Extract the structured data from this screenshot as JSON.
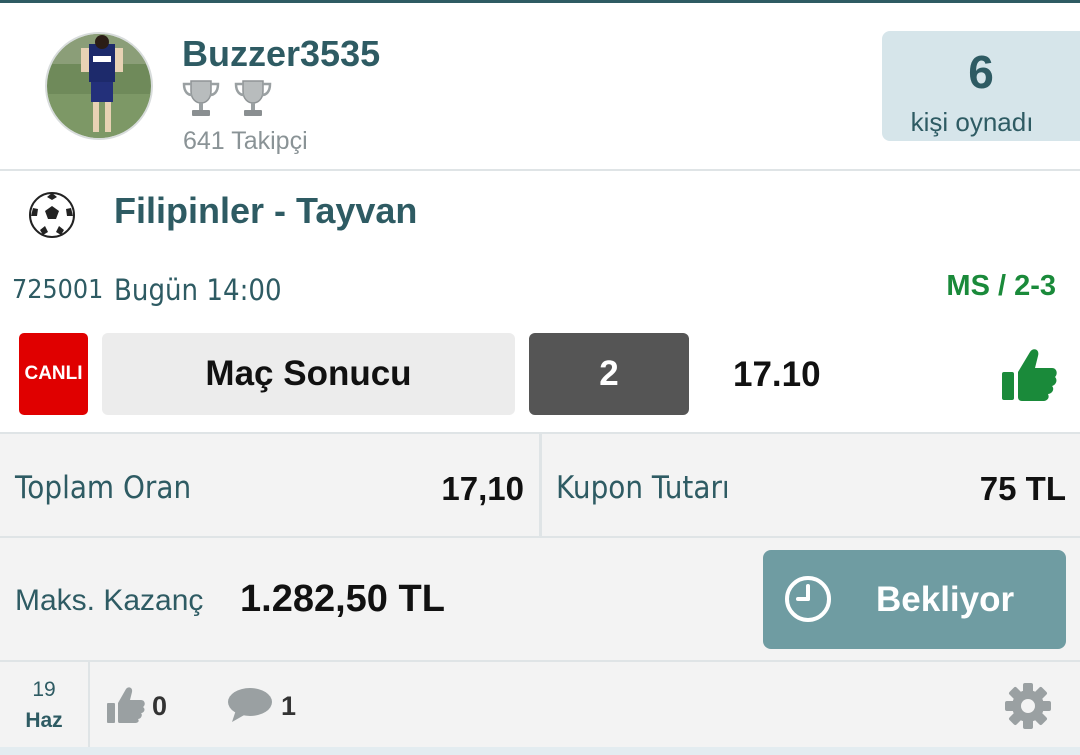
{
  "header": {
    "username": "Buzzer3535",
    "trophy_icons": [
      "trophy-icon",
      "trophy-icon"
    ],
    "followers": "641 Takipçi",
    "played_count": "6",
    "played_label": "kişi oynadı"
  },
  "match": {
    "sport_icon": "soccer-ball-icon",
    "title": "Filipinler - Tayvan",
    "code": "725001",
    "time": "Bugün 14:00",
    "pick": "MS / 2-3",
    "live_badge": "CANLI",
    "market": "Maç Sonucu",
    "selection": "2",
    "odds": "17.10",
    "result_icon": "thumbs-up-icon"
  },
  "totals": {
    "total_odds_label": "Toplam Oran",
    "total_odds_value": "17,10",
    "coupon_label": "Kupon Tutarı",
    "coupon_value": "75 TL"
  },
  "maxwin": {
    "label": "Maks. Kazanç",
    "value": "1.282,50 TL",
    "status": "Bekliyor",
    "status_icon": "clock-icon"
  },
  "footer": {
    "day": "19",
    "month": "Haz",
    "likes": "0",
    "comments": "1",
    "settings_icon": "gear-icon"
  },
  "colors": {
    "primary": "#2e5b63",
    "win_green": "#1a8a3a",
    "live_red": "#e00000",
    "status_button": "#6f9ca2",
    "played_box": "#d6e5ea"
  }
}
